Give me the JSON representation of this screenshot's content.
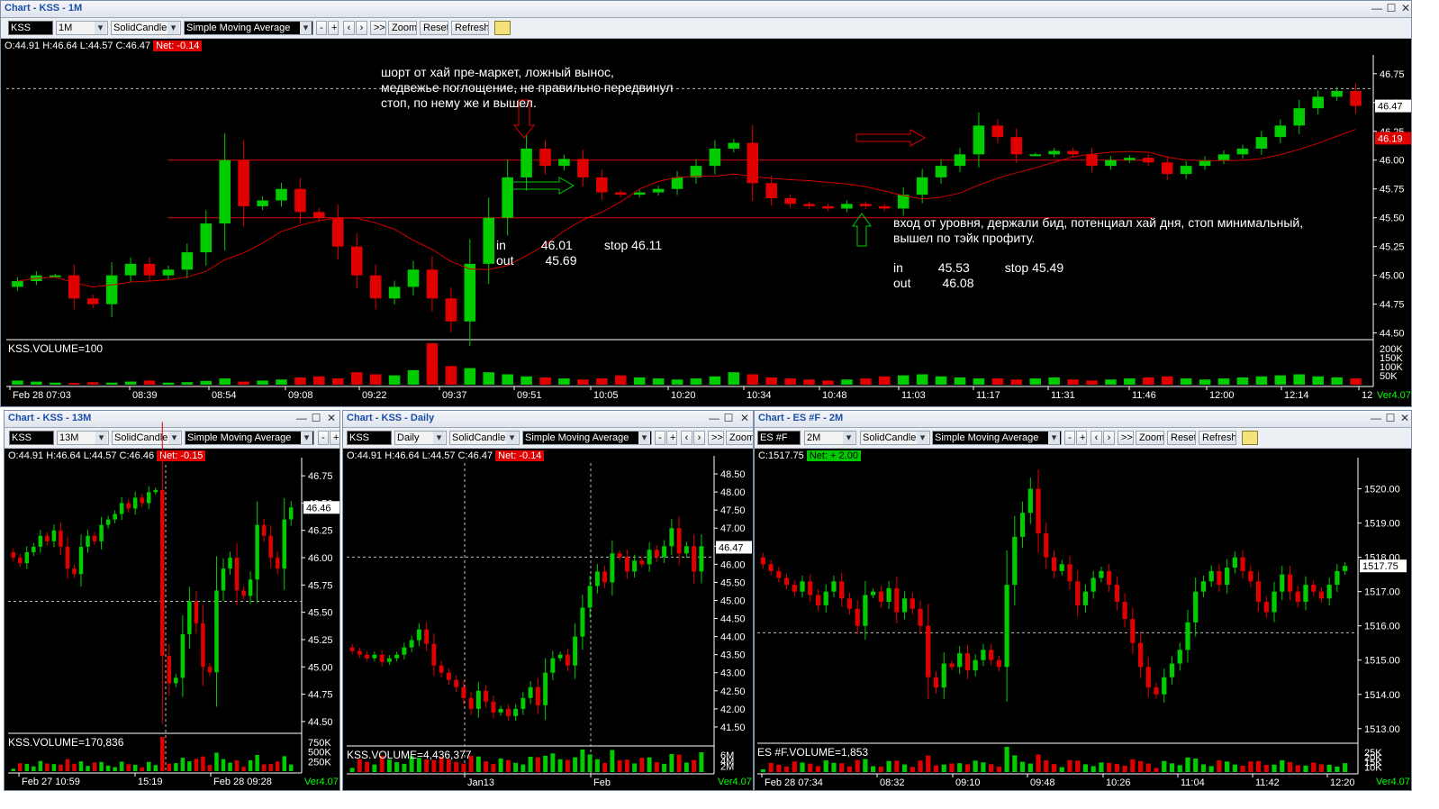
{
  "top": {
    "title": "Chart - KSS - 1M",
    "symbol": "KSS",
    "interval": "1M",
    "style": "SolidCandle",
    "study": "Simple Moving Average",
    "buttons": {
      "minus": "-",
      "plus": "+",
      "prev": "‹",
      "next": "›",
      "end": ">>|",
      "zoom": "Zoom",
      "reset": "Reset",
      "refresh": "Refresh"
    },
    "ohlc": "O:44.91  H:46.64  L:44.57  C:46.47",
    "net": "Net: -0.14",
    "last_tag": "46.47",
    "mark_tag": "46.19",
    "yticks": [
      "46.75",
      "46.50",
      "46.25",
      "46.00",
      "45.75",
      "45.50",
      "45.25",
      "45.00",
      "44.75",
      "44.50"
    ],
    "vol_label": "KSS.VOLUME=100",
    "vticks": [
      "200K",
      "150K",
      "100K",
      "50K"
    ],
    "xticks": [
      "Feb 28 07:03",
      "08:39",
      "08:54",
      "09:08",
      "09:22",
      "09:37",
      "09:51",
      "10:05",
      "10:20",
      "10:34",
      "10:48",
      "11:03",
      "11:17",
      "11:31",
      "11:46",
      "12:00",
      "12:14",
      "12"
    ],
    "ver": "Ver4.07",
    "note1": "шорт от хай пре-маркет, ложный вынос,\nмедвежье поглощение, не правильно передвинул\nстоп, по нему же и вышел.",
    "trade1": "in          46.01         stop 46.11\nout         45.69",
    "note2": "вход от уровня, держали бид, потенциал хай дня, стоп минимальный,\nвышел по тэйк профиту.",
    "trade2": "in          45.53          stop 45.49\nout         46.08"
  },
  "bl": {
    "title": "Chart - KSS - 13M",
    "symbol": "KSS",
    "interval": "13M",
    "style": "SolidCandle",
    "study": "Simple Moving Average",
    "ohlc": "O:44.91  H:46.64  L:44.57  C:46.46",
    "net": "Net: -0.15",
    "last_tag": "46.46",
    "yticks": [
      "46.75",
      "46.50",
      "46.25",
      "46.00",
      "45.75",
      "45.50",
      "45.25",
      "45.00",
      "44.75",
      "44.50"
    ],
    "vol_label": "KSS.VOLUME=170,836",
    "vticks": [
      "750K",
      "500K",
      "250K"
    ],
    "xticks": [
      "Feb 27 10:59",
      "15:19",
      "Feb 28 09:28"
    ],
    "ver": "Ver4.07"
  },
  "bm": {
    "title": "Chart - KSS - Daily",
    "symbol": "KSS",
    "interval": "Daily",
    "style": "SolidCandle",
    "study": "Simple Moving Average",
    "zoom": "Zoom",
    "ohlc": "O:44.91  H:46.64  L:44.57  C:46.47",
    "net": "Net: -0.14",
    "last_tag": "46.47",
    "yticks": [
      "48.50",
      "48.00",
      "47.50",
      "47.00",
      "46.50",
      "46.00",
      "45.50",
      "45.00",
      "44.50",
      "44.00",
      "43.50",
      "43.00",
      "42.50",
      "42.00",
      "41.50"
    ],
    "vol_label": "KSS.VOLUME=4,436,377",
    "vticks": [
      "6M",
      "4M",
      "2M"
    ],
    "xticks": [
      "Jan13",
      "Feb"
    ],
    "ver": "Ver4.07"
  },
  "br": {
    "title": "Chart - ES #F - 2M",
    "symbol": "ES #F",
    "interval": "2M",
    "style": "SolidCandle",
    "study": "Simple Moving Average",
    "buttons": {
      "minus": "-",
      "plus": "+",
      "prev": "‹",
      "next": "›",
      "end": ">>|",
      "zoom": "Zoom",
      "reset": "Reset",
      "refresh": "Refresh"
    },
    "ohlc": "C:1517.75",
    "net": "Net: + 2.00",
    "last_tag": "1517.75",
    "yticks": [
      "1520.00",
      "1519.00",
      "1518.00",
      "1517.00",
      "1516.00",
      "1515.00",
      "1514.00",
      "1513.00"
    ],
    "vol_label": "ES #F.VOLUME=1,853",
    "vticks": [
      "25K",
      "20K",
      "15K",
      "10K"
    ],
    "xticks": [
      "Feb 28 07:34",
      "08:32",
      "09:10",
      "09:48",
      "10:26",
      "11:04",
      "11:42",
      "12:20"
    ],
    "ver": "Ver4.07"
  },
  "colors": {
    "up": "#00cc00",
    "down": "#e00000",
    "net_neg": "#e00000",
    "net_pos": "#00c800",
    "ma": "#d00000"
  },
  "chart_data": [
    {
      "type": "candlestick",
      "title": "Chart - KSS - 1M",
      "ylim": [
        44.45,
        46.85
      ],
      "levels": [
        46.0,
        45.5
      ],
      "series": [
        {
          "name": "KSS",
          "close": [
            44.95,
            45.0,
            45.0,
            44.8,
            44.75,
            45.0,
            45.1,
            45.0,
            45.05,
            45.2,
            45.45,
            46.0,
            45.6,
            45.65,
            45.75,
            45.55,
            45.5,
            45.25,
            45.0,
            44.8,
            44.9,
            45.05,
            44.8,
            44.6,
            45.1,
            45.5,
            45.85,
            46.1,
            45.95,
            46.01,
            45.85,
            45.72,
            45.7,
            45.72,
            45.75,
            45.85,
            45.95,
            46.1,
            46.15,
            45.8,
            45.67,
            45.62,
            45.6,
            45.58,
            45.62,
            45.6,
            45.58,
            45.7,
            45.85,
            45.95,
            46.05,
            46.3,
            46.2,
            46.05,
            46.05,
            46.08,
            46.05,
            45.95,
            46.0,
            46.02,
            45.98,
            45.88,
            45.95,
            46.0,
            46.05,
            46.1,
            46.2,
            46.3,
            46.45,
            46.55,
            46.6,
            46.47
          ]
        }
      ],
      "volume": [
        20,
        15,
        10,
        8,
        12,
        10,
        15,
        20,
        10,
        12,
        18,
        30,
        15,
        20,
        25,
        35,
        40,
        30,
        60,
        50,
        45,
        70,
        200,
        90,
        80,
        60,
        50,
        40,
        35,
        30,
        25,
        30,
        45,
        35,
        30,
        25,
        30,
        40,
        60,
        50,
        35,
        30,
        25,
        20,
        25,
        30,
        40,
        45,
        50,
        40,
        35,
        30,
        30,
        25,
        30,
        35,
        25,
        20,
        25,
        30,
        35,
        40,
        30,
        25,
        30,
        35,
        40,
        45,
        50,
        40,
        35,
        30
      ],
      "volume_ticks": [
        "200K",
        "150K",
        "100K",
        "50K"
      ]
    },
    {
      "type": "candlestick",
      "title": "Chart - KSS - 13M",
      "ylim": [
        44.4,
        46.85
      ],
      "series": [
        {
          "name": "KSS",
          "close": [
            46.0,
            45.95,
            46.05,
            46.1,
            46.2,
            46.15,
            46.25,
            46.1,
            45.9,
            45.85,
            46.1,
            46.2,
            46.15,
            46.3,
            46.35,
            46.4,
            46.5,
            46.45,
            46.55,
            46.5,
            46.6,
            46.62,
            45.1,
            44.85,
            44.9,
            45.3,
            45.6,
            45.4,
            45.0,
            44.95,
            45.7,
            45.9,
            46.0,
            45.7,
            45.65,
            45.8,
            46.3,
            46.2,
            46.0,
            45.9,
            46.35,
            46.46
          ]
        }
      ],
      "volume_ticks": [
        "750K",
        "500K",
        "250K"
      ]
    },
    {
      "type": "candlestick",
      "title": "Chart - KSS - Daily",
      "ylim": [
        41.0,
        48.8
      ],
      "series": [
        {
          "name": "KSS",
          "close": [
            43.6,
            43.5,
            43.4,
            43.5,
            43.3,
            43.4,
            43.5,
            43.7,
            43.9,
            44.2,
            43.8,
            43.2,
            43.0,
            42.8,
            42.6,
            42.3,
            42.0,
            42.5,
            42.2,
            41.9,
            42.0,
            41.8,
            42.0,
            42.3,
            42.6,
            42.1,
            43.0,
            43.4,
            43.5,
            43.2,
            44.0,
            44.8,
            45.4,
            45.8,
            45.5,
            46.3,
            46.2,
            45.8,
            46.1,
            46.0,
            46.4,
            46.2,
            46.5,
            47.0,
            46.3,
            46.5,
            45.8,
            46.5
          ]
        }
      ],
      "volume_ticks": [
        "6M",
        "4M",
        "2M"
      ]
    },
    {
      "type": "candlestick",
      "title": "Chart - ES #F - 2M",
      "ylim": [
        1512.6,
        1520.7
      ],
      "series": [
        {
          "name": "ES #F",
          "close": [
            1517.8,
            1517.6,
            1517.4,
            1517.2,
            1517.0,
            1517.3,
            1516.9,
            1516.6,
            1517.0,
            1517.3,
            1516.8,
            1516.5,
            1516.0,
            1516.9,
            1517.0,
            1516.7,
            1517.1,
            1516.4,
            1516.8,
            1516.5,
            1516.0,
            1514.5,
            1514.2,
            1514.9,
            1514.8,
            1515.2,
            1514.7,
            1515.0,
            1515.3,
            1515.0,
            1514.8,
            1517.2,
            1518.6,
            1519.3,
            1520.0,
            1518.7,
            1518.0,
            1517.6,
            1517.8,
            1517.3,
            1516.6,
            1517.0,
            1517.4,
            1517.6,
            1517.2,
            1516.7,
            1516.2,
            1515.5,
            1514.8,
            1514.2,
            1514.0,
            1514.5,
            1514.9,
            1515.3,
            1516.1,
            1517.0,
            1517.3,
            1517.6,
            1517.2,
            1517.7,
            1518.0,
            1517.6,
            1517.3,
            1516.7,
            1516.4,
            1517.0,
            1517.5,
            1517.0,
            1516.7,
            1517.2,
            1517.0,
            1516.8,
            1517.2,
            1517.6,
            1517.75
          ]
        }
      ],
      "volume_ticks": [
        "25K",
        "20K",
        "15K",
        "10K"
      ]
    }
  ]
}
